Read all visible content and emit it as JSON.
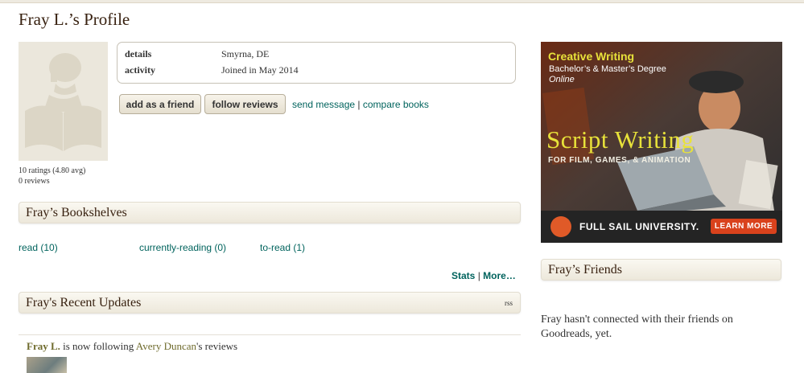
{
  "profile": {
    "title": "Fray L.’s Profile",
    "ratings_line": "10 ratings (4.80 avg)",
    "reviews_line": "0 reviews",
    "details_label": "details",
    "details_value": "Smyrna, DE",
    "activity_label": "activity",
    "activity_value": "Joined in May 2014"
  },
  "actions": {
    "add_friend": "add as a friend",
    "follow_reviews": "follow reviews",
    "send_message": "send message",
    "separator": "|",
    "compare_books": "compare books"
  },
  "bookshelves": {
    "header": "Fray’s Bookshelves",
    "shelves": [
      {
        "label": "read (10)"
      },
      {
        "label": "currently-reading (0)"
      },
      {
        "label": "to-read (1)"
      }
    ],
    "stats_link": "Stats",
    "separator": "|",
    "more_link": "More…"
  },
  "updates": {
    "header": "Fray's Recent Updates",
    "rss": "rss",
    "item": {
      "actor": "Fray L.",
      "text": " is now following ",
      "target": "Avery Duncan",
      "suffix": "'s reviews"
    }
  },
  "ad": {
    "line1": "Creative Writing",
    "line2": "Bachelor’s & Master’s Degree",
    "line3": "Online",
    "headline": "Script Writing",
    "subline": "FOR FILM, GAMES, & ANIMATION",
    "brand": "FULL SAIL UNIVERSITY.",
    "cta": "LEARN MORE"
  },
  "friends": {
    "header": "Fray’s Friends",
    "empty_text": "Fray hasn't connected with their friends on Goodreads, yet."
  },
  "colors": {
    "link_green": "#00635d",
    "title_brown": "#382110",
    "ad_yellow": "#e8e23a",
    "ad_orange": "#d9421c"
  }
}
